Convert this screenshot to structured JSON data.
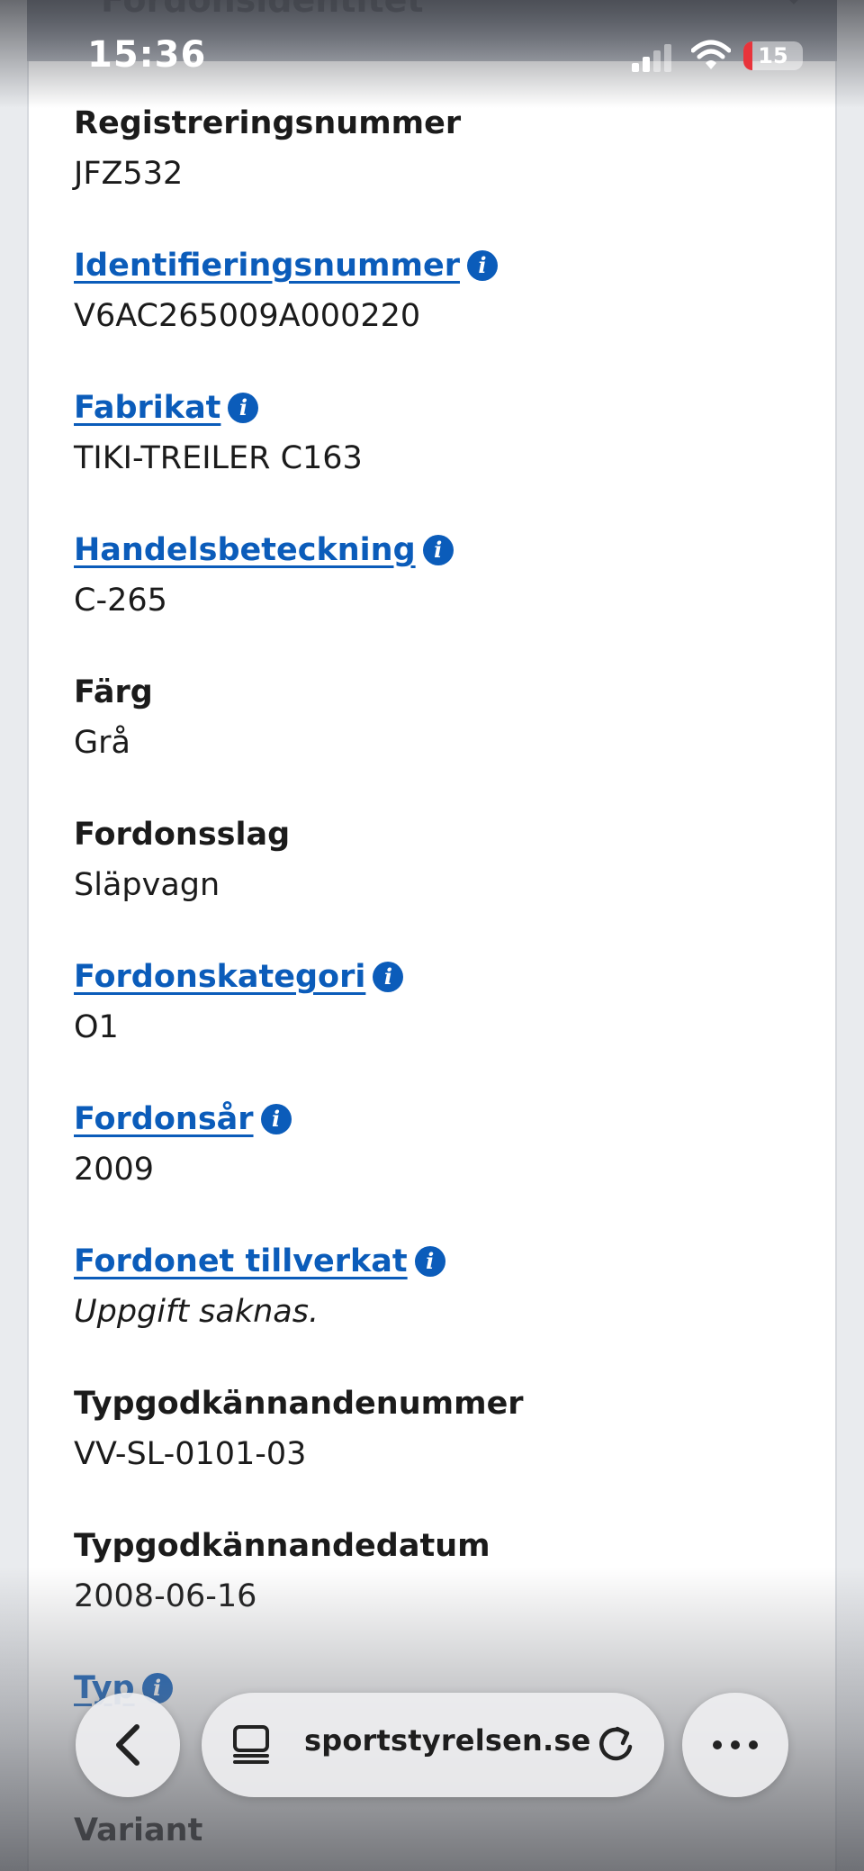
{
  "status_bar": {
    "time": "15:36",
    "battery_level": "15",
    "battery_fraction": 0.15,
    "battery_color": "#e8343b"
  },
  "modal": {
    "title": "Fordonsidentitet"
  },
  "fields": [
    {
      "label": "Registreringsnummer",
      "value": "JFZ532",
      "link": false
    },
    {
      "label": "Identifieringsnummer",
      "value": "V6AC265009A000220",
      "link": true
    },
    {
      "label": "Fabrikat",
      "value": "TIKI-TREILER C163",
      "link": true
    },
    {
      "label": "Handelsbeteckning",
      "value": "C-265",
      "link": true
    },
    {
      "label": "Färg",
      "value": "Grå",
      "link": false
    },
    {
      "label": "Fordonsslag",
      "value": "Släpvagn",
      "link": false
    },
    {
      "label": "Fordonskategori",
      "value": "O1",
      "link": true
    },
    {
      "label": "Fordonsår",
      "value": "2009",
      "link": true
    },
    {
      "label": "Fordonet tillverkat",
      "value": "Uppgift saknas.",
      "link": true,
      "italic": true
    },
    {
      "label": "Typgodkännandenummer",
      "value": "VV-SL-0101-03",
      "link": false
    },
    {
      "label": "Typgodkännandedatum",
      "value": "2008-06-16",
      "link": false
    },
    {
      "label": "Typ",
      "value": "",
      "link": true
    },
    {
      "label": "Variant",
      "value": "",
      "link": false
    }
  ],
  "browser_bar": {
    "url": "sportstyrelsen.se",
    "icons": [
      "back-icon",
      "tabs-icon",
      "reload-icon",
      "more-icon"
    ]
  },
  "colors": {
    "link": "#0b5cba",
    "text": "#1b1b1b"
  }
}
